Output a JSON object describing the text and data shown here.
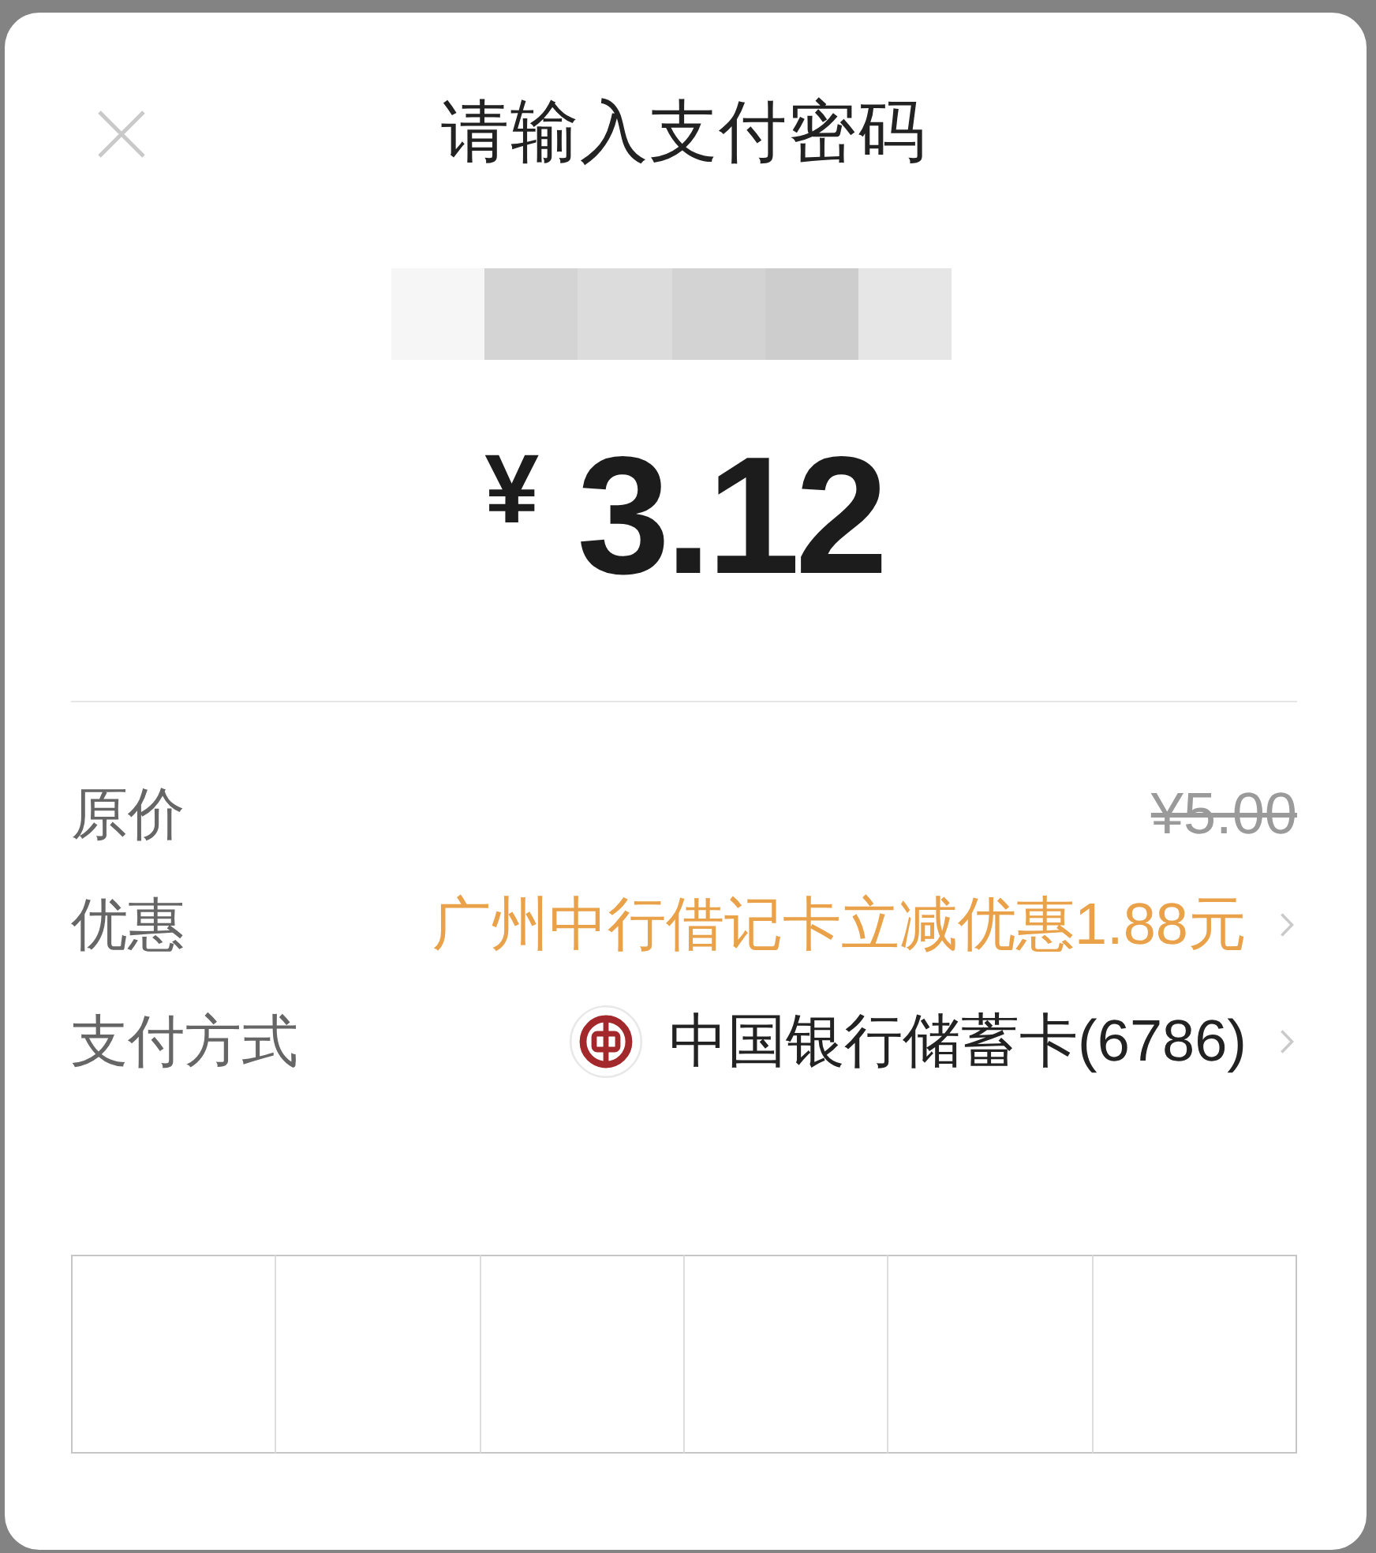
{
  "dialog": {
    "title": "请输入支付密码"
  },
  "amount": {
    "currency": "¥",
    "value": "3.12"
  },
  "details": [
    {
      "kind": "original_price",
      "label": "原价",
      "value": "¥5.00"
    },
    {
      "kind": "discount",
      "label": "优惠",
      "value": "广州中行借记卡立减优惠1.88元"
    },
    {
      "kind": "payment_method",
      "label": "支付方式",
      "value": "中国银行储蓄卡(6786)"
    }
  ],
  "password": {
    "digits": [
      {
        "filled": false
      },
      {
        "filled": false
      },
      {
        "filled": false
      },
      {
        "filled": false
      },
      {
        "filled": false
      },
      {
        "filled": false
      }
    ]
  }
}
